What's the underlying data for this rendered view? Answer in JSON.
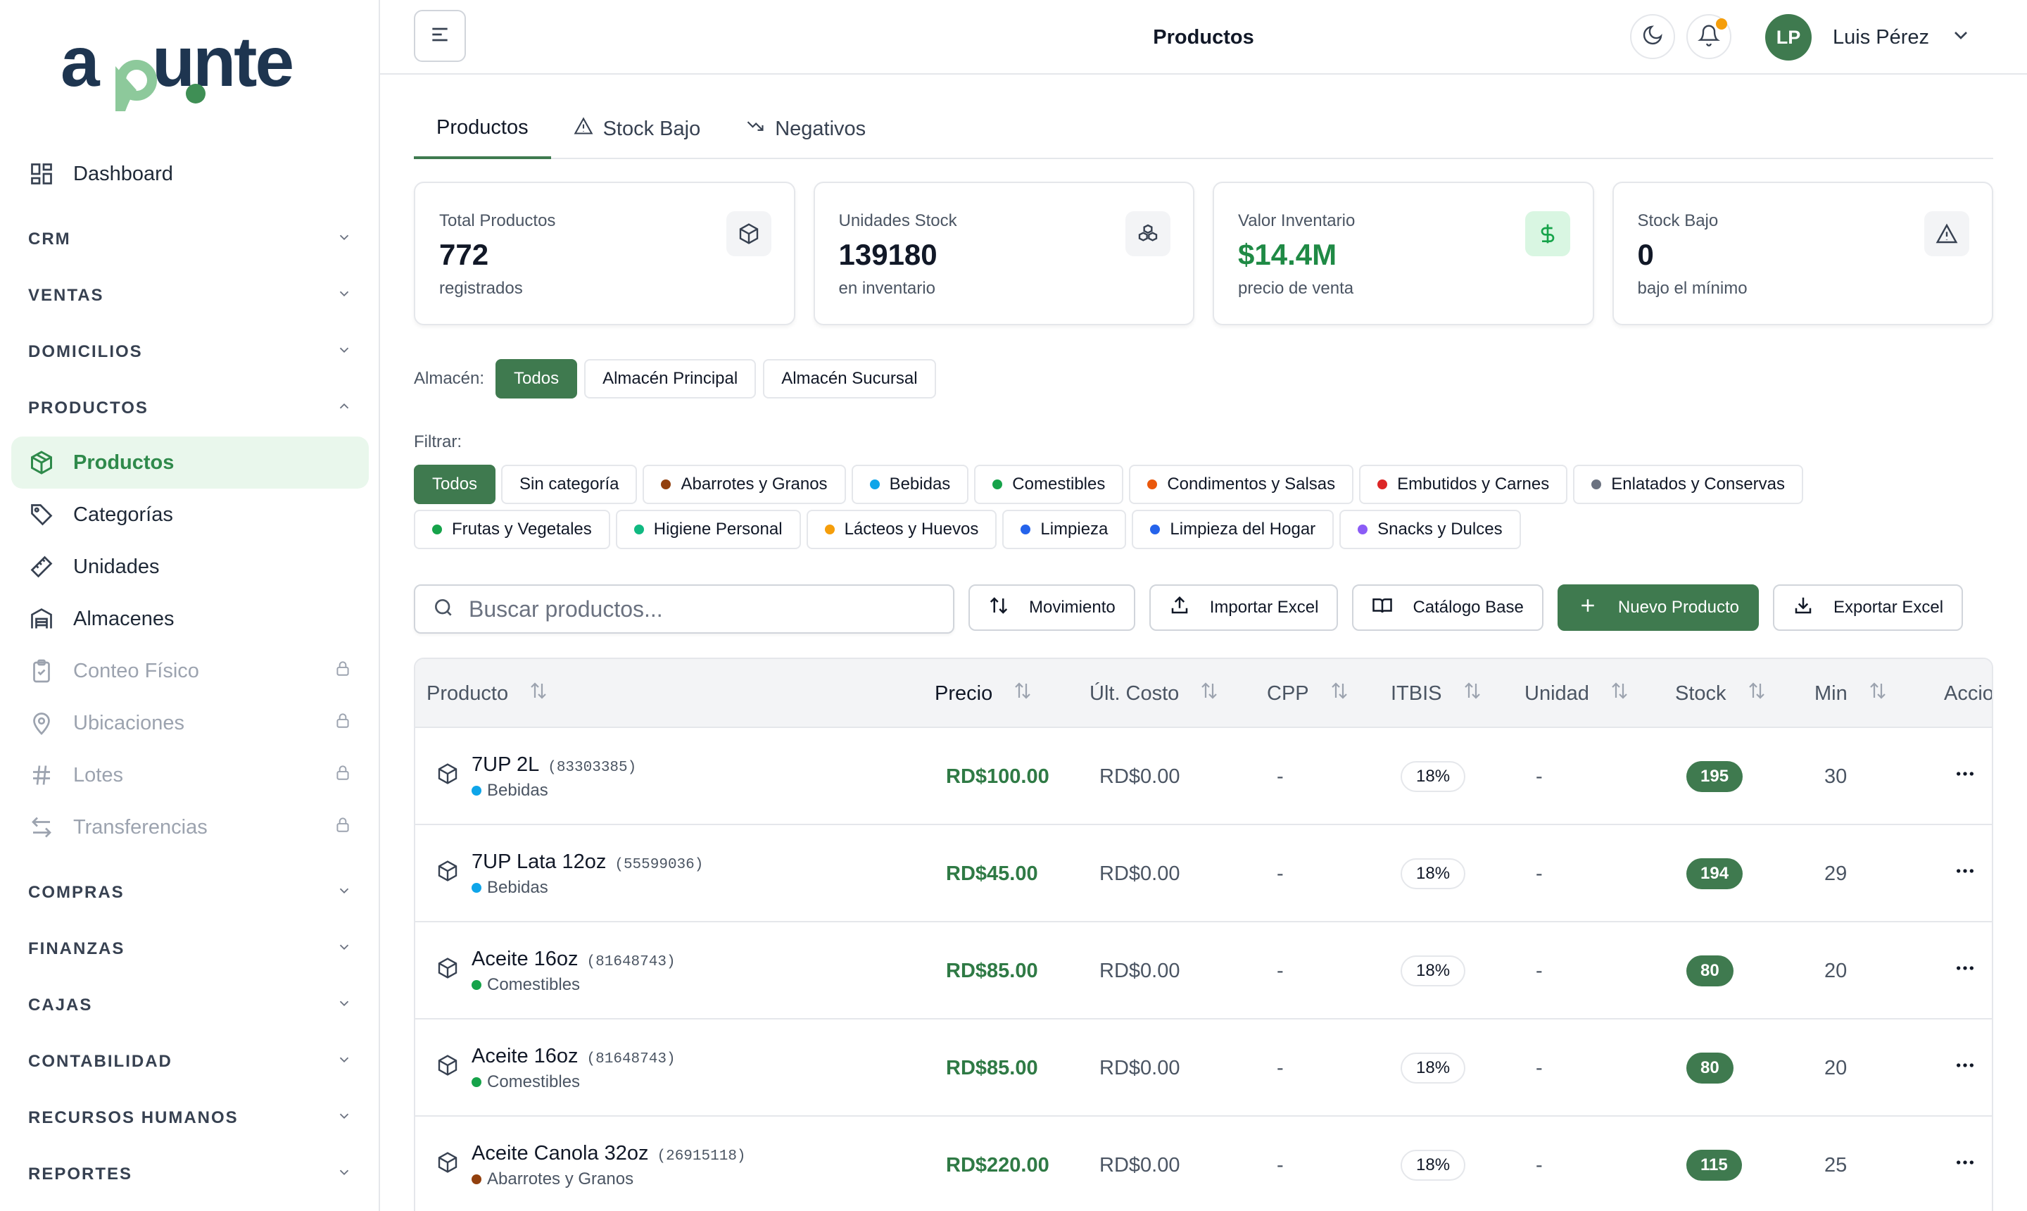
{
  "app": {
    "logo_text": "apunte"
  },
  "sidebar": {
    "dashboard": "Dashboard",
    "sections": {
      "crm": "CRM",
      "ventas": "VENTAS",
      "domicilios": "DOMICILIOS",
      "productos": "PRODUCTOS",
      "compras": "COMPRAS",
      "finanzas": "FINANZAS",
      "cajas": "CAJAS",
      "contabilidad": "CONTABILIDAD",
      "rrhh": "RECURSOS HUMANOS",
      "reportes": "REPORTES"
    },
    "productos_items": [
      "Productos",
      "Categorías",
      "Unidades",
      "Almacenes",
      "Conteo Físico",
      "Ubicaciones",
      "Lotes",
      "Transferencias"
    ]
  },
  "header": {
    "title": "Productos",
    "user_initials": "LP",
    "user_name": "Luis Pérez"
  },
  "tabs": [
    "Productos",
    "Stock Bajo",
    "Negativos"
  ],
  "stats": [
    {
      "label": "Total Productos",
      "value": "772",
      "sub": "registrados"
    },
    {
      "label": "Unidades Stock",
      "value": "139180",
      "sub": "en inventario"
    },
    {
      "label": "Valor Inventario",
      "value": "$14.4M",
      "sub": "precio de venta"
    },
    {
      "label": "Stock Bajo",
      "value": "0",
      "sub": "bajo el mínimo"
    }
  ],
  "warehouse": {
    "label": "Almacén:",
    "options": [
      "Todos",
      "Almacén Principal",
      "Almacén Sucursal"
    ]
  },
  "filter": {
    "label": "Filtrar:",
    "all": "Todos",
    "none": "Sin categoría",
    "categories": [
      {
        "name": "Abarrotes y Granos",
        "color": "#92400e"
      },
      {
        "name": "Bebidas",
        "color": "#0ea5e9"
      },
      {
        "name": "Comestibles",
        "color": "#16a34a"
      },
      {
        "name": "Condimentos y Salsas",
        "color": "#ea580c"
      },
      {
        "name": "Embutidos y Carnes",
        "color": "#dc2626"
      },
      {
        "name": "Enlatados y Conservas",
        "color": "#6b7280"
      },
      {
        "name": "Frutas y Vegetales",
        "color": "#16a34a"
      },
      {
        "name": "Higiene Personal",
        "color": "#10b981"
      },
      {
        "name": "Lácteos y Huevos",
        "color": "#f59e0b"
      },
      {
        "name": "Limpieza",
        "color": "#2563eb"
      },
      {
        "name": "Limpieza del Hogar",
        "color": "#2563eb"
      },
      {
        "name": "Snacks y Dulces",
        "color": "#8b5cf6"
      }
    ]
  },
  "toolbar": {
    "search_placeholder": "Buscar productos...",
    "movimiento": "Movimiento",
    "importar": "Importar Excel",
    "catalogo": "Catálogo Base",
    "nuevo": "Nuevo Producto",
    "exportar": "Exportar Excel"
  },
  "table": {
    "columns": [
      "Producto",
      "Precio",
      "Últ. Costo",
      "CPP",
      "ITBIS",
      "Unidad",
      "Stock",
      "Min",
      "Accio"
    ],
    "rows": [
      {
        "name": "7UP 2L",
        "code": "(83303385)",
        "category": "Bebidas",
        "cat_color": "#0ea5e9",
        "price": "RD$100.00",
        "cost": "RD$0.00",
        "cpp": "-",
        "itbis": "18%",
        "unit": "-",
        "stock": "195",
        "min": "30"
      },
      {
        "name": "7UP Lata 12oz",
        "code": "(55599036)",
        "category": "Bebidas",
        "cat_color": "#0ea5e9",
        "price": "RD$45.00",
        "cost": "RD$0.00",
        "cpp": "-",
        "itbis": "18%",
        "unit": "-",
        "stock": "194",
        "min": "29"
      },
      {
        "name": "Aceite 16oz",
        "code": "(81648743)",
        "category": "Comestibles",
        "cat_color": "#16a34a",
        "price": "RD$85.00",
        "cost": "RD$0.00",
        "cpp": "-",
        "itbis": "18%",
        "unit": "-",
        "stock": "80",
        "min": "20"
      },
      {
        "name": "Aceite 16oz",
        "code": "(81648743)",
        "category": "Comestibles",
        "cat_color": "#16a34a",
        "price": "RD$85.00",
        "cost": "RD$0.00",
        "cpp": "-",
        "itbis": "18%",
        "unit": "-",
        "stock": "80",
        "min": "20"
      },
      {
        "name": "Aceite Canola 32oz",
        "code": "(26915118)",
        "category": "Abarrotes y Granos",
        "cat_color": "#92400e",
        "price": "RD$220.00",
        "cost": "RD$0.00",
        "cpp": "-",
        "itbis": "18%",
        "unit": "-",
        "stock": "115",
        "min": "25"
      }
    ]
  },
  "colors": {
    "brand": "#3f7a4f",
    "accent_green": "#8dc99b",
    "active_bg": "#e9f7ec",
    "logo_dark": "#1e3550"
  },
  "icons": {
    "menu": "menu-icon",
    "moon": "moon-icon",
    "bell": "bell-icon",
    "chevron": "chevron-down-icon",
    "lock": "lock-icon",
    "box": "box-icon",
    "search": "search-icon",
    "sort": "sort-icon",
    "more": "more-icon"
  }
}
